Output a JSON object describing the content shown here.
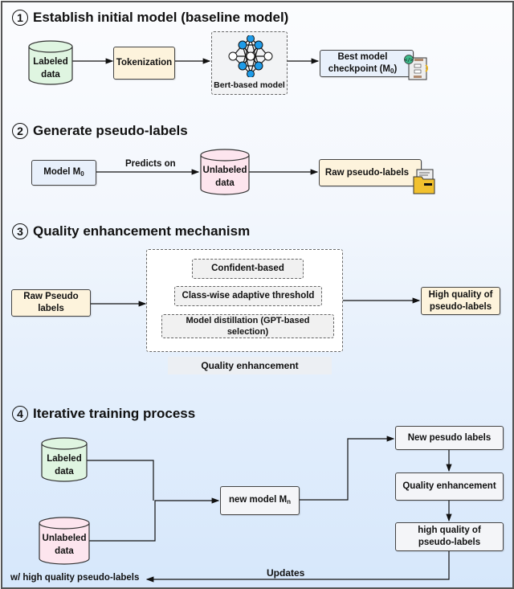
{
  "sections": [
    {
      "number": "1",
      "title": "Establish initial model (baseline model)"
    },
    {
      "number": "2",
      "title": "Generate pseudo-labels"
    },
    {
      "number": "3",
      "title": "Quality enhancement mechanism"
    },
    {
      "number": "4",
      "title": "Iterative training process"
    }
  ],
  "s1": {
    "labeled_data": [
      "Labeled",
      "data"
    ],
    "tokenization": "Tokenization",
    "bert_model": "Bert-based model",
    "best_checkpoint": [
      "Best model",
      "checkpoint (M",
      "0",
      ")"
    ]
  },
  "s2": {
    "model_m0": [
      "Model M",
      "0"
    ],
    "predicts_on": "Predicts on",
    "unlabeled_data": [
      "Unlabeled",
      "data"
    ],
    "raw_pseudo": "Raw pseudo-labels"
  },
  "s3": {
    "raw_pseudo": [
      "Raw Pseudo",
      "labels"
    ],
    "confident": "Confident-based",
    "classwise": "Class-wise adaptive threshold",
    "distillation": [
      "Model distillation (GPT-based",
      "selection)"
    ],
    "group_label": "Quality enhancement",
    "high_quality": [
      "High quality of",
      "pseudo-labels"
    ]
  },
  "s4": {
    "labeled_data": [
      "Labeled",
      "data"
    ],
    "unlabeled_data": [
      "Unlabeled",
      "data"
    ],
    "new_model": [
      "new model M",
      "n"
    ],
    "new_pseudo": "New pesudo labels",
    "quality": "Quality enhancement",
    "high_quality": [
      "high quality of",
      "pseudo-labels"
    ],
    "updates": "Updates",
    "feedback": "w/ high quality pseudo-labels"
  },
  "colors": {
    "green_cylinder": "#dff5e1",
    "pink_cylinder": "#fde5ee",
    "blue_box": "#e8f0fb",
    "cream_box": "#fdf3dc",
    "node_blue": "#1e9be8"
  }
}
